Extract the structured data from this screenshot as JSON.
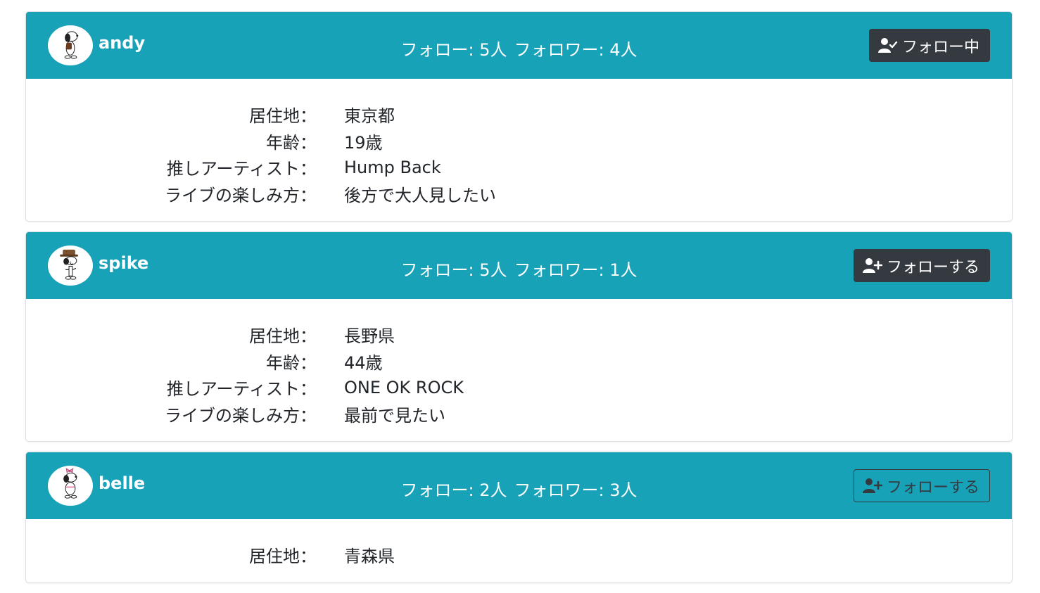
{
  "users": [
    {
      "name": "andy",
      "follow_label": "フォロー: 5人",
      "follower_label": "フォロワー: 4人",
      "button": {
        "label": "フォロー中",
        "state": "following",
        "icon": "user-check-icon"
      },
      "details": [
        {
          "label": "居住地：",
          "value": "東京都"
        },
        {
          "label": "年齢：",
          "value": "19歳"
        },
        {
          "label": "推しアーティスト：",
          "value": "Hump Back"
        },
        {
          "label": "ライブの楽しみ方：",
          "value": "後方で大人見したい"
        }
      ]
    },
    {
      "name": "spike",
      "follow_label": "フォロー: 5人",
      "follower_label": "フォロワー: 1人",
      "button": {
        "label": "フォローする",
        "state": "follow",
        "icon": "user-plus-icon"
      },
      "details": [
        {
          "label": "居住地：",
          "value": "長野県"
        },
        {
          "label": "年齢：",
          "value": "44歳"
        },
        {
          "label": "推しアーティスト：",
          "value": "ONE OK ROCK"
        },
        {
          "label": "ライブの楽しみ方：",
          "value": "最前で見たい"
        }
      ]
    },
    {
      "name": "belle",
      "follow_label": "フォロー: 2人",
      "follower_label": "フォロワー: 3人",
      "button": {
        "label": "フォローする",
        "state": "follow-outline",
        "icon": "user-plus-icon"
      },
      "details": [
        {
          "label": "居住地：",
          "value": "青森県"
        }
      ]
    }
  ],
  "colors": {
    "header": "#17a2b8",
    "button_dark": "#343a40",
    "card_border": "#dcdfe3"
  }
}
